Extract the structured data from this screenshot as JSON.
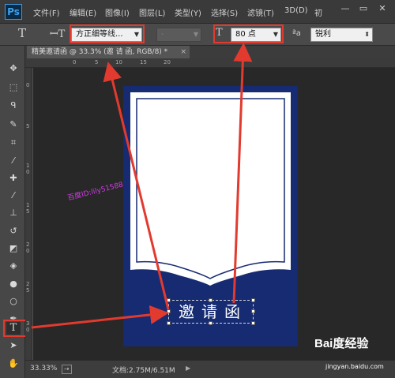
{
  "app": {
    "logo": "Ps"
  },
  "menu": {
    "items": [
      "文件(F)",
      "编辑(E)",
      "图像(I)",
      "图层(L)",
      "类型(Y)",
      "选择(S)",
      "滤镜(T)",
      "3D(D)",
      "初"
    ]
  },
  "window_controls": {
    "minimize": "—",
    "restore": "▭",
    "close": "✕"
  },
  "options_bar": {
    "font_family": "方正细等线...",
    "font_style": "-",
    "font_size": "80 点",
    "aa_label": "ªa",
    "antialias": "锐利"
  },
  "document_tab": {
    "title": "精美邀请函 @ 33.3% (邀 请 函, RGB/8) *",
    "close": "×"
  },
  "ruler": {
    "top_ticks": [
      "0",
      "5",
      "10",
      "15",
      "20"
    ],
    "left_ticks": [
      "0",
      "5",
      "1 0",
      "1 5",
      "2 0",
      "2 5",
      "3 0"
    ]
  },
  "canvas": {
    "watermark": "百度ID:lily51588",
    "text_layer": "邀请函"
  },
  "status_bar": {
    "zoom": "33.33%",
    "doc_info": "文档:2.75M/6.51M"
  },
  "brand": {
    "logo": "Bai度经验",
    "url": "jingyan.baidu.com"
  },
  "colors": {
    "accent": "#e23a2e",
    "invitation_blue": "#162b72",
    "watermark": "#d33be8"
  },
  "icons": [
    "text-tool-icon",
    "text-orientation-icon",
    "font-size-icon",
    "move-tool-icon",
    "marquee-icon",
    "lasso-icon",
    "quick-select-icon",
    "crop-icon",
    "eyedropper-icon",
    "healing-brush-icon",
    "brush-icon",
    "clone-stamp-icon",
    "history-brush-icon",
    "eraser-icon",
    "paint-bucket-icon",
    "blur-icon",
    "dodge-icon",
    "pen-icon",
    "path-select-icon",
    "hand-icon"
  ]
}
